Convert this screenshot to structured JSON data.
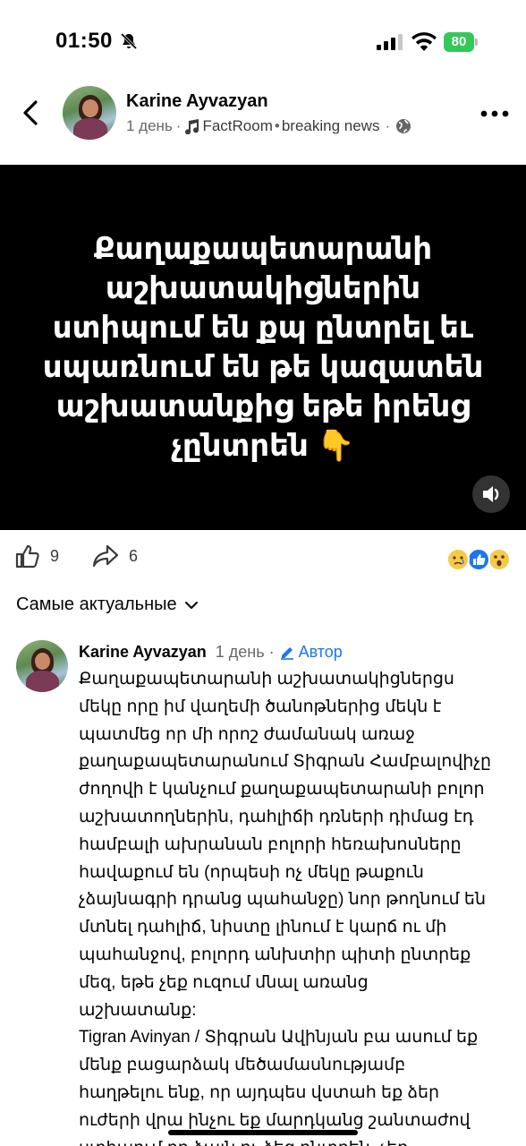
{
  "status": {
    "time": "01:50",
    "battery": "80",
    "icons": [
      "bell-off-icon",
      "cellular-signal-icon",
      "wifi-icon",
      "battery-icon"
    ]
  },
  "post": {
    "author": "Karine Ayvazyan",
    "time": "1 день",
    "audio": "FactRoom",
    "audio_track": "breaking news",
    "icons": [
      "back-icon",
      "music-note-icon",
      "globe-icon",
      "more-icon"
    ]
  },
  "video": {
    "caption": "Քաղաքապետարանի աշխատակիցներին ստիպում են քպ ընտրել եւ սպառնում են թե կազատեն աշխատանքից եթե իրենց չընտրեն 👇"
  },
  "actions": {
    "likes": "9",
    "shares": "6",
    "reactions": [
      "sad",
      "like",
      "wow"
    ],
    "colors": {
      "like": "#1877f2",
      "emoji": "#f7c948"
    }
  },
  "sort": {
    "label": "Самые актуальные"
  },
  "comment": {
    "author": "Karine Ayvazyan",
    "time": "1 день",
    "badge": "Автор",
    "lines": [
      "Քաղաքապետարանի  աշխատակիցներցս",
      "մեկը որը իմ վաղեմի ծանոթներից մեկն է",
      "պատմեց որ մի որոշ ժամանակ առաջ",
      "քաղաքապետարանում Տիգրան Համբալովիչը",
      "ժողովի է կանչում քաղաքապետարանի բոլոր",
      "աշխատողներին, դահլիճի դռների դիմաց էդ",
      "համբալի ախրանան բոլորի հեռախոսները",
      "հավաքում են (որպեսի ոչ մեկը թաքուն",
      "չձայնագրի դրանց պահանջը) նոր թողնում են",
      "մտնել դահլիճ, նիստը լինում է կարճ ու մի",
      "պահանջով, բոլորդ անխտիր պիտի ընտրեք",
      "մեզ, եթե չեք ուզում մնալ առանց",
      "աշխատանք:",
      "Tigran Avinyan / Տիգրան Ավինյան բա ասում եք",
      "մենք բացարձակ մեծամասնությամբ",
      "հաղթելու ենք, որ այդպես վստահ եք ձեր",
      "ուժերի վրա ինչու եք մարդկանց շանտաժով",
      "ստիպում որ ձայն ու ձեզ ընտրեն, չեք"
    ]
  }
}
